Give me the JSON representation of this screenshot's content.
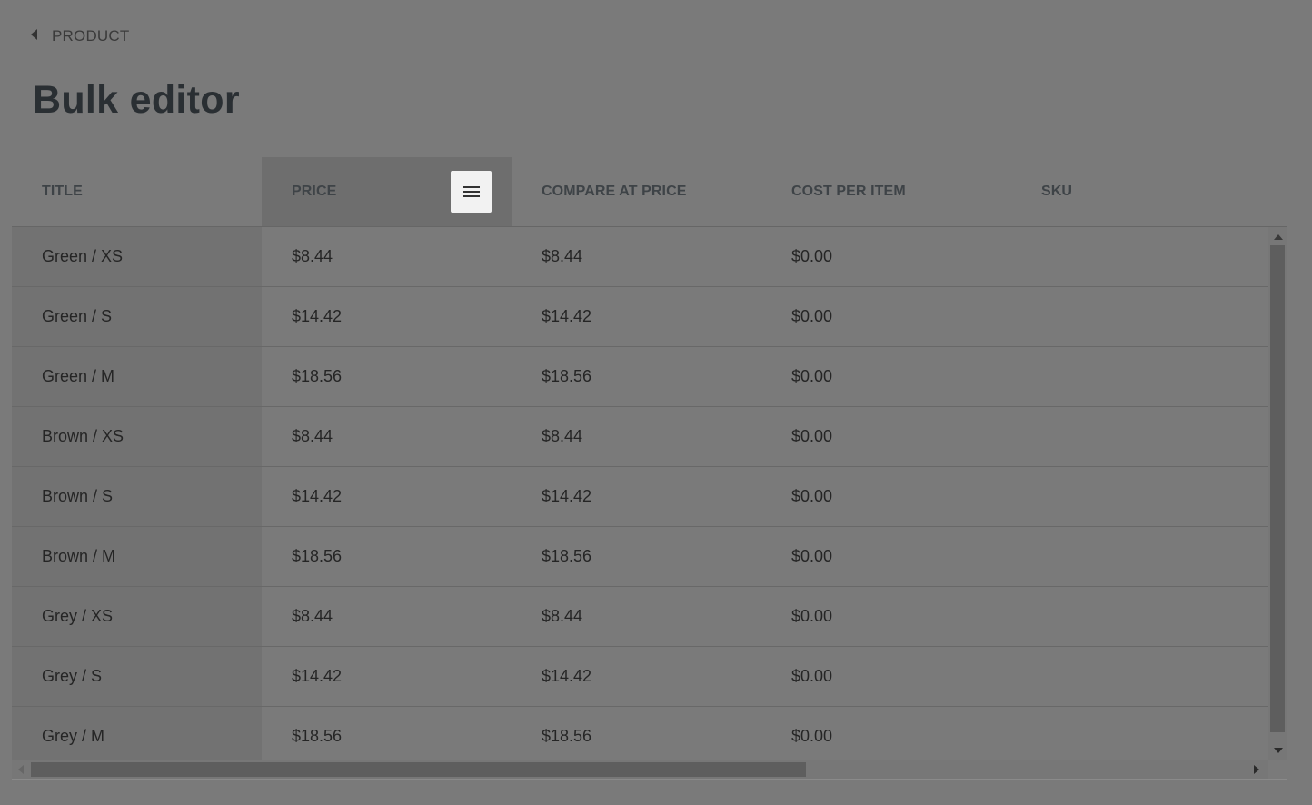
{
  "breadcrumb": {
    "label": "PRODUCT"
  },
  "page": {
    "title": "Bulk editor"
  },
  "grid": {
    "columns": [
      "TITLE",
      "PRICE",
      "COMPARE AT PRICE",
      "COST PER ITEM",
      "SKU"
    ],
    "active_column": "PRICE",
    "rows": [
      {
        "title": "Green / XS",
        "price": "$8.44",
        "compare_at_price": "$8.44",
        "cost_per_item": "$0.00",
        "sku": ""
      },
      {
        "title": "Green / S",
        "price": "$14.42",
        "compare_at_price": "$14.42",
        "cost_per_item": "$0.00",
        "sku": ""
      },
      {
        "title": "Green / M",
        "price": "$18.56",
        "compare_at_price": "$18.56",
        "cost_per_item": "$0.00",
        "sku": ""
      },
      {
        "title": "Brown / XS",
        "price": "$8.44",
        "compare_at_price": "$8.44",
        "cost_per_item": "$0.00",
        "sku": ""
      },
      {
        "title": "Brown / S",
        "price": "$14.42",
        "compare_at_price": "$14.42",
        "cost_per_item": "$0.00",
        "sku": ""
      },
      {
        "title": "Brown / M",
        "price": "$18.56",
        "compare_at_price": "$18.56",
        "cost_per_item": "$0.00",
        "sku": ""
      },
      {
        "title": "Grey / XS",
        "price": "$8.44",
        "compare_at_price": "$8.44",
        "cost_per_item": "$0.00",
        "sku": ""
      },
      {
        "title": "Grey / S",
        "price": "$14.42",
        "compare_at_price": "$14.42",
        "cost_per_item": "$0.00",
        "sku": ""
      },
      {
        "title": "Grey / M",
        "price": "$18.56",
        "compare_at_price": "$18.56",
        "cost_per_item": "$0.00",
        "sku": ""
      }
    ]
  },
  "icons": {
    "back": "chevron-left-icon",
    "column_menu": "menu-icon"
  },
  "colors": {
    "overlay_background": "#7a7a7a",
    "title_text": "#2a2f33",
    "menu_button_bg": "#f2f2f2"
  }
}
